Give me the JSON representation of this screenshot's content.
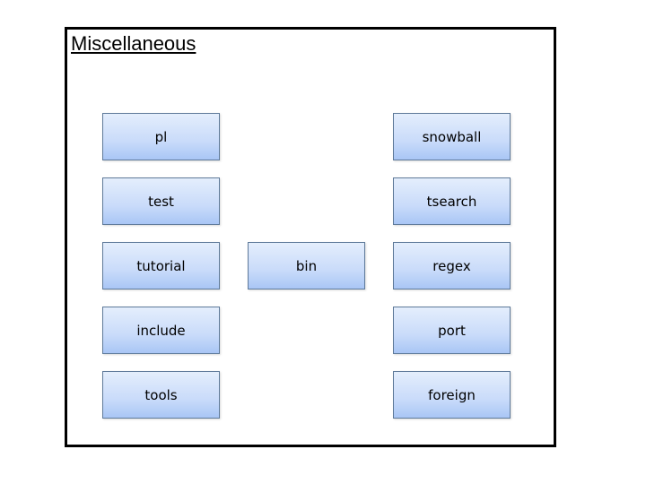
{
  "title": "Miscellaneous",
  "nodes": {
    "left": [
      "pl",
      "test",
      "tutorial",
      "include",
      "tools"
    ],
    "center": [
      "bin"
    ],
    "right": [
      "snowball",
      "tsearch",
      "regex",
      "port",
      "foreign"
    ]
  },
  "colors": {
    "node_top": "#e4eefc",
    "node_bottom": "#a9c6f5",
    "node_border": "#5f7a9a",
    "frame_border": "#000000"
  }
}
